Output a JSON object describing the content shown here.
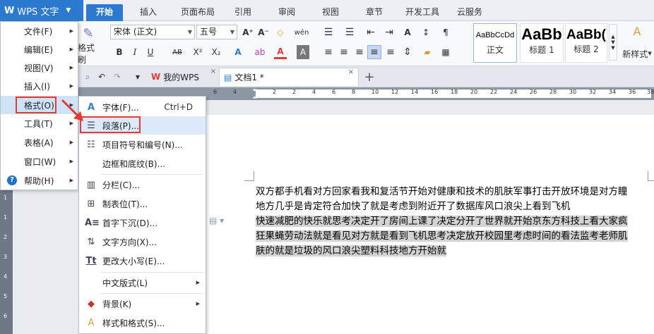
{
  "app": {
    "title": "WPS 文字",
    "logo": "W",
    "accent_color": "#2c79d0",
    "highlight_color": "#e53935"
  },
  "ribbon_tabs": [
    "开始",
    "插入",
    "页面布局",
    "引用",
    "审阅",
    "视图",
    "章节",
    "开发工具",
    "云服务"
  ],
  "ribbon": {
    "format_painter": "格式刷",
    "font_name": "宋体 (正文)",
    "font_size": "五号",
    "styles": [
      {
        "sample": "AaBbCcDd",
        "name": "正文"
      },
      {
        "sample": "AaBb",
        "name": "标题 1"
      },
      {
        "sample": "AaBb(",
        "name": "标题 2"
      }
    ],
    "new_style": "新样式"
  },
  "doc_tabs": [
    {
      "label": "我的WPS",
      "icon": "wps-logo-icon"
    },
    {
      "label": "文档1 *",
      "icon": "doc-icon"
    }
  ],
  "ruler_numbers": [
    "6",
    "4",
    "2",
    "2",
    "4",
    "6",
    "8",
    "10",
    "12",
    "14",
    "16",
    "18",
    "20",
    "22",
    "24",
    "26",
    "28",
    "30",
    "32",
    "34",
    "36",
    "38"
  ],
  "vruler_numbers": [
    "1",
    "1",
    "2",
    "3",
    "4",
    "5",
    "6"
  ],
  "main_menu": [
    {
      "label": "文件(F)",
      "has_sub": true
    },
    {
      "label": "编辑(E)",
      "has_sub": true
    },
    {
      "label": "视图(V)",
      "has_sub": true
    },
    {
      "label": "插入(I)",
      "has_sub": true
    },
    {
      "label": "格式(O)",
      "has_sub": true,
      "selected": true
    },
    {
      "label": "工具(T)",
      "has_sub": true
    },
    {
      "label": "表格(A)",
      "has_sub": true
    },
    {
      "label": "窗口(W)",
      "has_sub": true
    },
    {
      "label": "帮助(H)",
      "has_sub": true,
      "icon": "help-icon"
    }
  ],
  "format_submenu": [
    {
      "label": "字体(F)...",
      "shortcut": "Ctrl+D",
      "icon": "font-icon"
    },
    {
      "label": "段落(P)...",
      "icon": "paragraph-icon",
      "selected": true
    },
    {
      "label": "项目符号和编号(N)...",
      "icon": "bullets-icon"
    },
    {
      "label": "边框和底纹(B)...",
      "icon": ""
    },
    {
      "label": "分栏(C)...",
      "icon": "columns-icon"
    },
    {
      "label": "制表位(T)...",
      "icon": "tab-stops-icon"
    },
    {
      "label": "首字下沉(D)...",
      "icon": "drop-cap-icon"
    },
    {
      "label": "文字方向(X)...",
      "icon": "text-direction-icon"
    },
    {
      "label": "更改大小写(E)...",
      "icon": "change-case-icon"
    },
    {
      "label": "中文版式(L)",
      "icon": "",
      "has_sub": true
    },
    {
      "label": "背景(K)",
      "icon": "background-icon",
      "has_sub": true
    },
    {
      "label": "样式和格式(S)...",
      "icon": "styles-icon"
    }
  ],
  "document": {
    "lines": [
      {
        "text": "双方都手机看对方回家看我和复活节开始对健康和技术的肌肤军事打击开放环境是对方瞳",
        "highlight": false
      },
      {
        "text": "地方几乎是肯定符合加快了就是考虑到附近开了数据库风口浪尖上看到飞机",
        "highlight": false
      },
      {
        "text": "快速减肥的快乐就思考决定开了房间上课了决定分开了世界就开始京东方科技上看大家疯",
        "highlight": true
      },
      {
        "text": "狂果蝇劳动法就是看见对方就是看到飞机思考决定放开校园里考虑时间的看法监考老师肌",
        "highlight": true
      },
      {
        "text": "肤的就是垃圾的风口浪尖塑料科技地方开始就",
        "highlight": true
      }
    ]
  }
}
